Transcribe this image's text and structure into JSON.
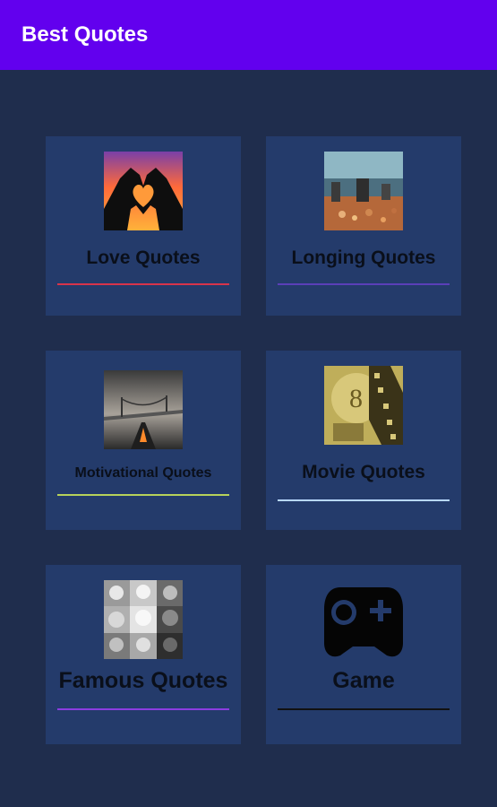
{
  "app_bar": {
    "title": "Best Quotes",
    "color": "#6200ee"
  },
  "cards": [
    {
      "label": "Love Quotes",
      "underline_color": "#d8344a",
      "icon": "heart-hands-icon"
    },
    {
      "label": "Longing Quotes",
      "underline_color": "#5b3fb8",
      "icon": "crowd-photo-icon"
    },
    {
      "label": "Motivational Quotes",
      "underline_color": "#b7d25a",
      "icon": "road-bridge-icon"
    },
    {
      "label": "Movie Quotes",
      "underline_color": "#b8d8ff",
      "icon": "film-strip-icon"
    },
    {
      "label": "Famous Quotes",
      "underline_color": "#8b3de0",
      "icon": "portraits-collage-icon"
    },
    {
      "label": "Game",
      "underline_color": "#111111",
      "icon": "gamepad-icon"
    }
  ]
}
